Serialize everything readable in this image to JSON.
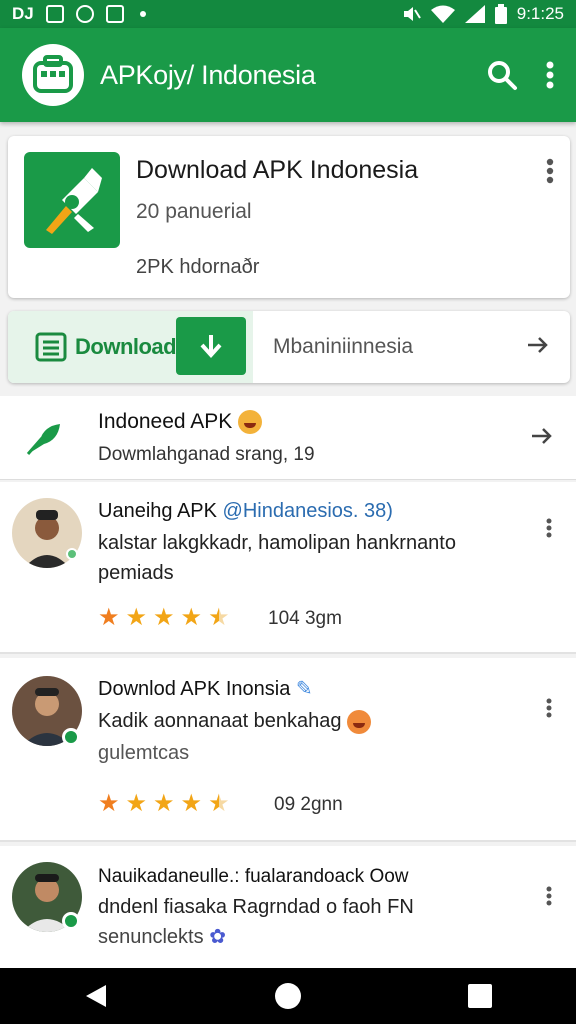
{
  "status_bar": {
    "time": "9:1:25",
    "left_icons": [
      "notification-icon",
      "image-icon",
      "sync-icon",
      "app-icon"
    ],
    "right_icons": [
      "mute-icon",
      "wifi-icon",
      "signal-icon",
      "battery-icon"
    ],
    "left_text": "DJ"
  },
  "app_bar": {
    "title": "APKojy/ Indonesia",
    "logo_icon": "briefcase-icon",
    "actions": [
      "search-icon",
      "more-vert-icon"
    ]
  },
  "hero": {
    "title": "Download APK Indonesia",
    "subtitle": "20 panuerial",
    "meta": "2PK hdornaðr"
  },
  "download_bar": {
    "label": "Download",
    "right_text": "Mbaniniinnesia"
  },
  "feature": {
    "title": "Indoneed APK",
    "subtitle": "Dowmlahganad srang, 19"
  },
  "reviews": [
    {
      "name": "Uaneihg APK",
      "handle": "@Hindanesios. 38)",
      "text": "kalstar lakgkkadr, hamolipan hankrnanto pemiads",
      "stars": 4.5,
      "meta": "104 3gm"
    },
    {
      "name": "Downlod APK Inonsia",
      "text": "Kadik aonnanaat benkahag",
      "extra": "gulemtcas",
      "stars": 4.5,
      "meta": "09 2gnn"
    },
    {
      "name": "Nauikadaneulle.: fualarandoack Oow",
      "text": "dndenl fiasaka Ragrndad o faoh  FN",
      "extra": "senunclekts"
    }
  ],
  "colors": {
    "primary": "#1a9a48",
    "status_bar": "#13893f",
    "star": "#f2a516",
    "star_first": "#f07e1f"
  }
}
